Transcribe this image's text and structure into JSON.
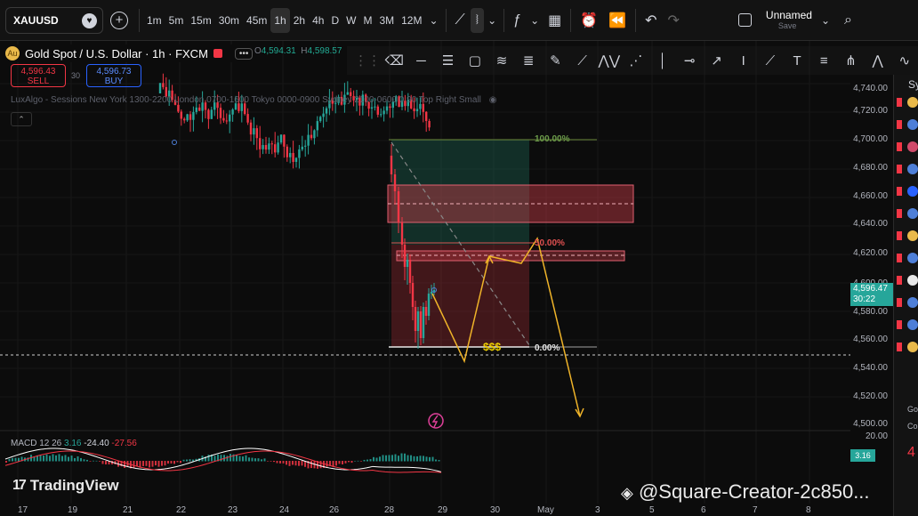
{
  "toolbar": {
    "symbol": "XAUUSD",
    "timeframes": [
      "1m",
      "5m",
      "15m",
      "30m",
      "45m",
      "1h",
      "2h",
      "4h",
      "D",
      "W",
      "M",
      "3M",
      "12M"
    ],
    "active_timeframe": "1h",
    "layout_name": "Unnamed",
    "layout_status": "Save"
  },
  "legend": {
    "title": "Gold Spot / U.S. Dollar · 1h · FXCM",
    "open": "4,594.31",
    "high": "4,598.57",
    "sell_price": "4,596.43",
    "sell_label": "SELL",
    "buy_price": "4,596.73",
    "buy_label": "BUY",
    "spread": "30",
    "sessions_indicator": "LuxAlgo - Sessions New York 1300-2200 London 0700-1600 Tokyo 0000-0900 Sydney 2100-0600 0 90 Top Right Small"
  },
  "price_axis": {
    "ticks": [
      "4,740.00",
      "4,720.00",
      "4,700.00",
      "4,680.00",
      "4,660.00",
      "4,640.00",
      "4,620.00",
      "4,600.00",
      "4,580.00",
      "4,560.00",
      "4,540.00",
      "4,520.00",
      "4,500.00",
      "20.00"
    ],
    "current_price": "4,596.47",
    "countdown": "30:22",
    "macd_value": "3.16"
  },
  "time_axis": {
    "ticks": [
      "17",
      "19",
      "21",
      "22",
      "23",
      "24",
      "26",
      "28",
      "29",
      "30",
      "May",
      "3",
      "5",
      "6",
      "7",
      "8"
    ]
  },
  "fib_levels": {
    "top": "100.00%",
    "mid": "50.00%",
    "bottom": "0.00%",
    "liquidity": "$$$"
  },
  "macd": {
    "label": "MACD 12 26",
    "macd": "3.16",
    "signal": "-24.40",
    "hist": "-27.56"
  },
  "watermarks": {
    "brand": "TradingView",
    "creator": "@Square-Creator-2c850..."
  },
  "watchlist": {
    "header": "Sy",
    "side_a": "Go",
    "side_b": "Co",
    "side_c": "4"
  },
  "colors": {
    "up": "#26a69a",
    "down": "#f23645",
    "accent": "#2962ff",
    "projection": "#f0b429"
  }
}
